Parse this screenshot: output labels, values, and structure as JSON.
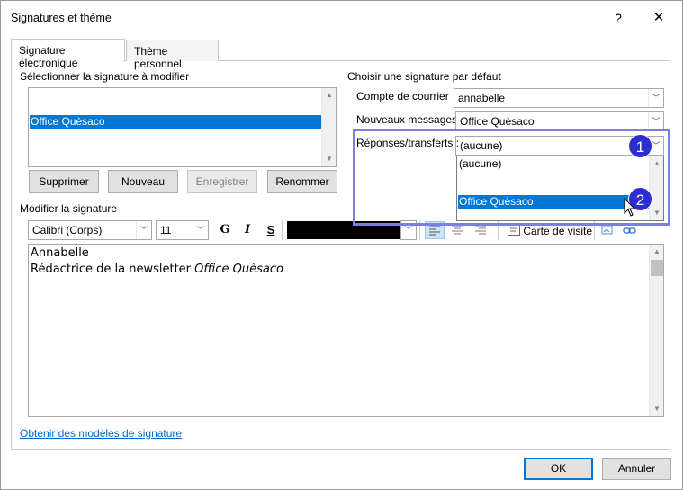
{
  "window": {
    "title": "Signatures et thème",
    "help": "?",
    "close": "✕"
  },
  "tabs": [
    "Signature électronique",
    "Thème personnel"
  ],
  "left": {
    "select_label": "Sélectionner la signature à modifier",
    "signatures": [
      "Office Quèsaco"
    ],
    "buttons": {
      "delete": "Supprimer",
      "new": "Nouveau",
      "save": "Enregistrer",
      "rename": "Renommer"
    }
  },
  "right": {
    "group_label": "Choisir une signature par défaut",
    "account_label": "Compte de courrier",
    "account_value": "annabelle",
    "new_messages_label": "Nouveaux messages :",
    "new_messages_value": "Office Quèsaco",
    "replies_label": "Réponses/transferts :",
    "replies_value": "(aucune)",
    "replies_options": [
      "(aucune)",
      "Office Quèsaco"
    ]
  },
  "edit": {
    "label": "Modifier la signature",
    "font": "Calibri (Corps)",
    "size": "11",
    "bold": "G",
    "italic": "I",
    "underline": "S",
    "business_card": "Carte de visite",
    "lines": [
      {
        "text": "Annabelle"
      },
      {
        "text": "Rédactrice de la newsletter ",
        "italic": "Office Quèsaco"
      }
    ]
  },
  "link": "Obtenir des modèles de signature",
  "footer": {
    "ok": "OK",
    "cancel": "Annuler"
  },
  "badges": [
    "1",
    "2"
  ],
  "colors": {
    "selection": "#0078d7",
    "highlight": "#7b7fe0",
    "badge": "#2b2fcf",
    "link": "#0066cc"
  }
}
